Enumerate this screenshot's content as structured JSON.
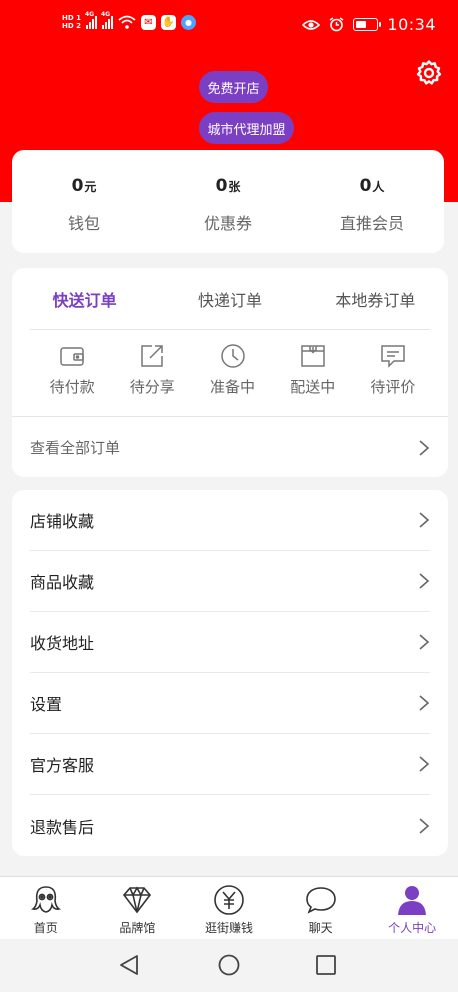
{
  "status_bar": {
    "time": "10:34",
    "network": [
      "HD 1",
      "HD 2",
      "4G",
      "4G"
    ],
    "battery_fraction": 0.55,
    "icons": [
      "wifi-icon",
      "mail-icon",
      "app-icon",
      "browser-icon",
      "eye-icon",
      "alarm-icon",
      "battery-icon"
    ]
  },
  "header": {
    "settings_icon": "gear-icon",
    "open_shop_label": "免费开店",
    "city_agent_label": "城市代理加盟"
  },
  "stats": [
    {
      "value": "0",
      "unit": "元",
      "label": "钱包"
    },
    {
      "value": "0",
      "unit": "张",
      "label": "优惠券"
    },
    {
      "value": "0",
      "unit": "人",
      "label": "直推会员"
    }
  ],
  "orders": {
    "tabs": [
      {
        "label": "快送订单",
        "active": true
      },
      {
        "label": "快递订单",
        "active": false
      },
      {
        "label": "本地券订单",
        "active": false
      }
    ],
    "statuses": [
      {
        "label": "待付款",
        "icon": "wallet-icon"
      },
      {
        "label": "待分享",
        "icon": "share-icon"
      },
      {
        "label": "准备中",
        "icon": "clock-icon"
      },
      {
        "label": "配送中",
        "icon": "box-icon"
      },
      {
        "label": "待评价",
        "icon": "comment-icon"
      }
    ],
    "view_all_label": "查看全部订单"
  },
  "menu": [
    {
      "label": "店铺收藏"
    },
    {
      "label": "商品收藏"
    },
    {
      "label": "收货地址"
    },
    {
      "label": "设置"
    },
    {
      "label": "官方客服"
    },
    {
      "label": "退款售后"
    }
  ],
  "tabbar": [
    {
      "label": "首页",
      "icon": "octopus-icon",
      "active": false
    },
    {
      "label": "品牌馆",
      "icon": "diamond-icon",
      "active": false
    },
    {
      "label": "逛街赚钱",
      "icon": "yen-coin-icon",
      "active": false
    },
    {
      "label": "聊天",
      "icon": "chat-bubble-icon",
      "active": false
    },
    {
      "label": "个人中心",
      "icon": "user-icon",
      "active": true
    }
  ],
  "colors": {
    "header": "#ff0000",
    "accent": "#7b3fc4",
    "background": "#f3f3f3"
  }
}
